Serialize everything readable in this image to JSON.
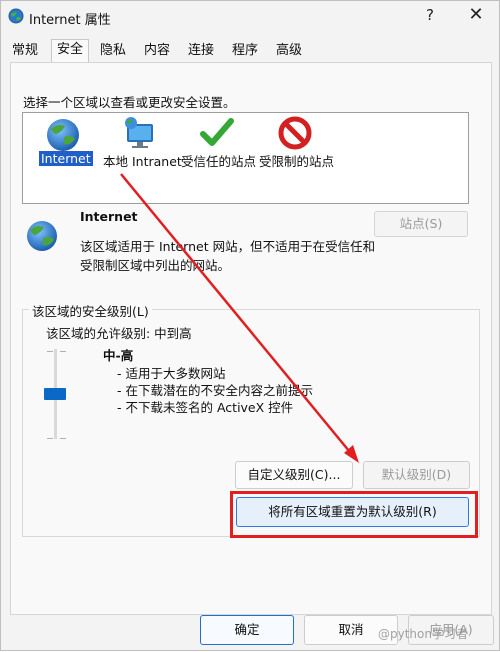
{
  "window": {
    "title": "Internet 属性",
    "help_glyph": "?",
    "close_glyph": "✕"
  },
  "tabs": [
    {
      "label": "常规",
      "active": false
    },
    {
      "label": "安全",
      "active": true
    },
    {
      "label": "隐私",
      "active": false
    },
    {
      "label": "内容",
      "active": false
    },
    {
      "label": "连接",
      "active": false
    },
    {
      "label": "程序",
      "active": false
    },
    {
      "label": "高级",
      "active": false
    }
  ],
  "zones": {
    "instruction": "选择一个区域以查看或更改安全设置。",
    "items": [
      {
        "label": "Internet",
        "icon": "globe-icon",
        "selected": true
      },
      {
        "label": "本地 Intranet",
        "icon": "monitor-globe-icon",
        "selected": false
      },
      {
        "label": "受信任的站点",
        "icon": "checkmark-icon",
        "selected": false
      },
      {
        "label": "受限制的站点",
        "icon": "no-entry-icon",
        "selected": false
      }
    ]
  },
  "zone_info": {
    "title": "Internet",
    "description_line1": "该区域适用于 Internet 网站，但不适用于在受信任和",
    "description_line2": "受限制区域中列出的网站。",
    "sites_button": "站点(S)"
  },
  "security_level": {
    "group_title": "该区域的安全级别(L)",
    "allowed_levels": "该区域的允许级别: 中到高",
    "level_name": "中-高",
    "bullets": [
      "- 适用于大多数网站",
      "- 在下载潜在的不安全内容之前提示",
      "- 不下载未签名的 ActiveX 控件"
    ],
    "custom_button": "自定义级别(C)...",
    "default_button": "默认级别(D)",
    "reset_button": "将所有区域重置为默认级别(R)"
  },
  "footer": {
    "ok_button": "确定",
    "cancel_button": "取消",
    "apply_button": "应用(A)"
  },
  "watermark": "@python学习者",
  "colors": {
    "accent": "#1f5fc7",
    "slider_thumb": "#0a68c7",
    "highlight_red": "#e02020"
  }
}
